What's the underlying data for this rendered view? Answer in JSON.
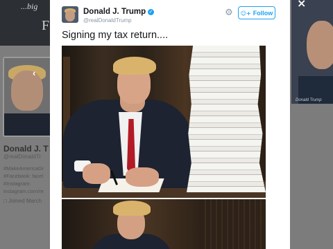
{
  "background": {
    "header_text": "...big",
    "header_letter": "F",
    "profile_name": "Donald J. T",
    "profile_handle": "@realDonaldTr",
    "bio_lines": [
      "#MakeAmericaGr",
      "#Facebook: facel",
      "#Instagram:",
      "instagram.com/re"
    ],
    "joined_text": "Joined March",
    "right_caption": "Donald Trump"
  },
  "modal": {
    "close_label": "×",
    "tweet": {
      "author_name": "Donald J. Trump",
      "author_handle": "@realDonaldTrump",
      "verified_glyph": "✓",
      "settings_icon": "gear-icon",
      "follow_label": "Follow",
      "text": "Signing my tax return...."
    },
    "media": {
      "photo_1": "man-signing-with-paper-stack",
      "photo_2": "man-at-desk-second-photo"
    }
  },
  "colors": {
    "accent": "#1da1f2",
    "overlay": "#7b7b7b",
    "tie": "#b31b26"
  }
}
